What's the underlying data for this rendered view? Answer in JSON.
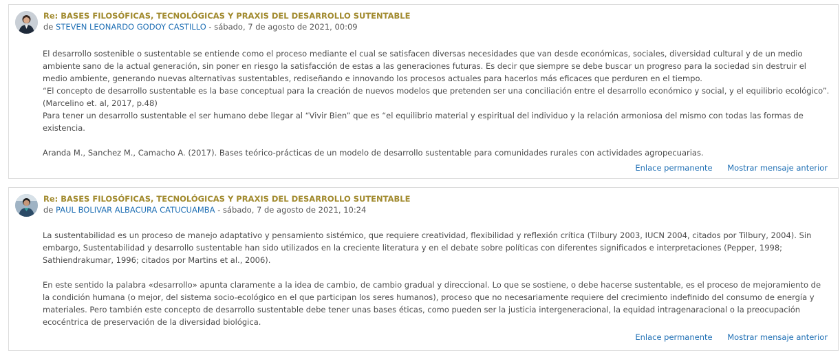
{
  "posts": [
    {
      "subject": "Re: BASES FILOSÓFICAS, TECNOLÓGICAS Y PRAXIS DEL DESARROLLO SUTENTABLE",
      "by_prefix": "de",
      "author": "STEVEN LEONARDO GODOY CASTILLO",
      "date": "- sábado, 7 de agosto de 2021, 00:09",
      "paragraphs": [
        "El desarrollo sostenible o sustentable se entiende como el proceso mediante el cual se satisfacen diversas necesidades que van desde económicas, sociales, diversidad cultural y de un medio ambiente sano de la actual generación, sin poner en riesgo la satisfacción de estas a las generaciones futuras. Es decir que siempre se debe buscar un progreso para la sociedad sin destruir el medio ambiente, generando nuevas alternativas sustentables, rediseñando e innovando los procesos actuales para hacerlos más eficaces que perduren en el tiempo.",
        "“El concepto de desarrollo sustentable es la base conceptual para la creación de nuevos modelos que pretenden ser una conciliación entre el desarrollo económico y social, y el equilibrio ecológico”. (Marcelino et. al, 2017, p.48)",
        "Para tener un desarrollo sustentable el ser humano debe llegar al “Vivir Bien” que es “el equilibrio material y espiritual del individuo y la relación armoniosa del mismo con todas las formas de existencia.",
        "",
        "Aranda M., Sanchez M., Camacho A. (2017). Bases teórico-prácticas de un modelo de desarrollo sustentable para comunidades rurales con actividades agropecuarias."
      ],
      "permalink": "Enlace permanente",
      "show_parent": "Mostrar mensaje anterior"
    },
    {
      "subject": "Re: BASES FILOSÓFICAS, TECNOLÓGICAS Y PRAXIS DEL DESARROLLO SUTENTABLE",
      "by_prefix": "de",
      "author": "PAUL BOLIVAR ALBACURA CATUCUAMBA",
      "date": "- sábado, 7 de agosto de 2021, 10:24",
      "paragraphs": [
        "La sustentabilidad es un proceso de manejo adaptativo y pensamiento sistémico, que requiere creatividad, flexibilidad y reflexión crítica (Tilbury 2003, IUCN 2004, citados por Tilbury, 2004). Sin embargo, Sustentabilidad y desarrollo sustentable han sido utilizados en la creciente literatura y en el debate sobre políticas con diferentes significados e interpretaciones (Pepper, 1998; Sathiendrakumar, 1996; citados por Martins et al., 2006).",
        "",
        "En este sentido la palabra «desarrollo» apunta claramente a la idea de cambio, de cambio gradual y direccional. Lo que se sostiene, o debe hacerse sustentable, es el proceso de mejoramiento de la condición humana (o mejor, del sistema socio-ecológico en el que participan los seres humanos), proceso que no necesariamente requiere del crecimiento indefinido del consumo de energía y materiales. Pero también este concepto de desarrollo sustentable debe tener unas bases éticas, como pueden ser la justicia intergeneracional, la equidad intragenaracional o la preocupación ecocéntrica de preservación de la diversidad biológica."
      ],
      "permalink": "Enlace permanente",
      "show_parent": "Mostrar mensaje anterior"
    }
  ]
}
